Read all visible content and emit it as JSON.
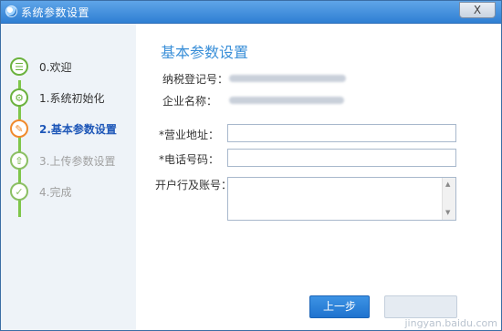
{
  "window": {
    "title": "系统参数设置",
    "close_label": "X"
  },
  "steps": [
    {
      "label": "0.欢迎",
      "state": "done",
      "icon": "welcome-monitor-icon",
      "glyph": "☰"
    },
    {
      "label": "1.系统初始化",
      "state": "done",
      "icon": "gear-icon",
      "glyph": "⚙"
    },
    {
      "label": "2.基本参数设置",
      "state": "current",
      "icon": "user-edit-icon",
      "glyph": "✎"
    },
    {
      "label": "3.上传参数设置",
      "state": "todo",
      "icon": "upload-tray-icon",
      "glyph": "⇧"
    },
    {
      "label": "4.完成",
      "state": "todo",
      "icon": "checkmark-icon",
      "glyph": "✓"
    }
  ],
  "main": {
    "title": "基本参数设置",
    "tax_id_label": "纳税登记号：",
    "company_name_label": "企业名称：",
    "address_label": "*营业地址：",
    "phone_label": "*电话号码：",
    "bank_label": "开户行及账号：",
    "address_value": "",
    "phone_value": "",
    "bank_value": ""
  },
  "buttons": {
    "prev_label": "上一步"
  },
  "watermark": "jingyan.baidu.com",
  "colors": {
    "titlebar": "#2f7fd3",
    "accent": "#3a8fd8",
    "current_step": "#1e57b8",
    "done_step": "#6bb23e",
    "current_icon": "#f08a2c",
    "button": "#1f73cf"
  }
}
